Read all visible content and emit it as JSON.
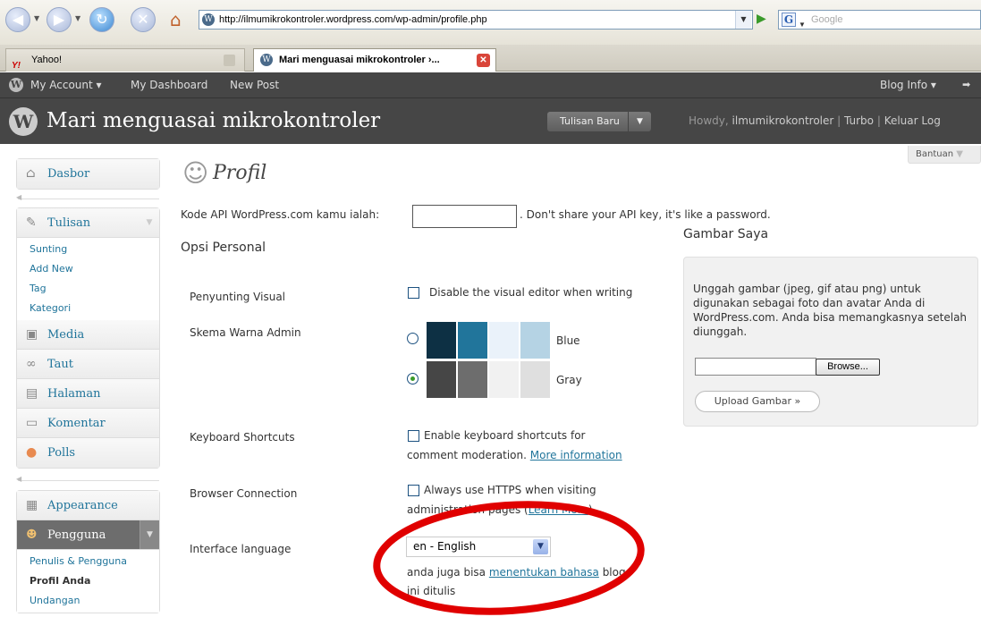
{
  "browser": {
    "url": "http://ilmumikrokontroler.wordpress.com/wp-admin/profile.php",
    "search_placeholder": "Google",
    "tabs": [
      {
        "label": "Yahoo!"
      },
      {
        "label": "Mari menguasai mikrokontroler ›..."
      }
    ]
  },
  "adminbar": {
    "my_account": "My Account ▾",
    "dashboard": "My Dashboard",
    "new_post": "New Post",
    "blog_info": "Blog Info ▾"
  },
  "header": {
    "site_title": "Mari menguasai mikrokontroler",
    "new_post_button": "Tulisan Baru",
    "howdy_prefix": "Howdy, ",
    "username": "ilmumikrokontroler",
    "turbo": "Turbo",
    "logout": "Keluar Log"
  },
  "sidebar": {
    "dashboard": "Dasbor",
    "posts": "Tulisan",
    "posts_sub": [
      "Sunting",
      "Add New",
      "Tag",
      "Kategori"
    ],
    "media": "Media",
    "links": "Taut",
    "pages": "Halaman",
    "comments": "Komentar",
    "polls": "Polls",
    "appearance": "Appearance",
    "users": "Pengguna",
    "users_sub": [
      "Penulis & Pengguna",
      "Profil Anda",
      "Undangan"
    ]
  },
  "main": {
    "help": "Bantuan",
    "page_title": "Profil",
    "api_label": "Kode API WordPress.com kamu ialah:",
    "api_note": ". Don't share your API key, it's like a password.",
    "section_title": "Opsi Personal",
    "visual_editor_label": "Penyunting Visual",
    "visual_editor_text": "Disable the visual editor when writing",
    "color_scheme_label": "Skema Warna Admin",
    "scheme_blue": "Blue",
    "scheme_gray": "Gray",
    "shortcuts_label": "Keyboard Shortcuts",
    "shortcuts_text_1": "Enable keyboard shortcuts for",
    "shortcuts_text_2": "comment moderation.",
    "shortcuts_link": "More information",
    "browser_conn_label": "Browser Connection",
    "https_text_1": "Always use HTTPS when visiting",
    "https_text_2": "administration pages (",
    "https_link": "Learn More",
    "https_text_3": ")",
    "language_label": "Interface language",
    "language_value": "en - English",
    "lang_note_1": "anda juga bisa ",
    "lang_note_link": "menentukan bahasa",
    "lang_note_2": " blog",
    "lang_note_3": "ini ditulis"
  },
  "gambar": {
    "title": "Gambar Saya",
    "description": "Unggah gambar (jpeg, gif atau png) untuk digunakan sebagai foto dan avatar Anda di WordPress.com. Anda bisa memangkasnya setelah diunggah.",
    "browse": "Browse...",
    "upload": "Upload Gambar »"
  },
  "colors": {
    "blue_scheme": [
      "#0d3044",
      "#21759b",
      "#eaf2fa",
      "#b5d3e4"
    ],
    "gray_scheme": [
      "#464646",
      "#6d6d6d",
      "#f1f1f1",
      "#dfdfdf"
    ],
    "annotation": "#e00000"
  }
}
